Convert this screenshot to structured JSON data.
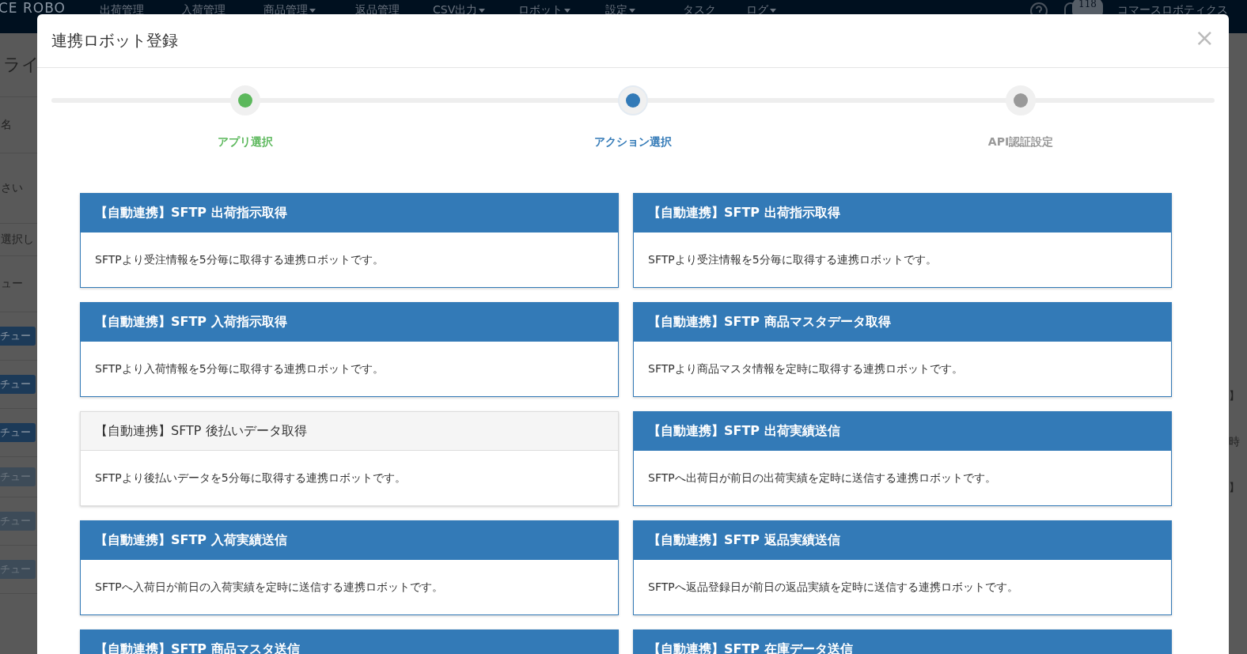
{
  "navbar": {
    "logo": "CE ROBO",
    "items": [
      {
        "label": "出荷管理",
        "dropdown": false
      },
      {
        "label": "入荷管理",
        "dropdown": false
      },
      {
        "label": "商品管理",
        "dropdown": true
      },
      {
        "label": "返品管理",
        "dropdown": false
      },
      {
        "label": "CSV出力",
        "dropdown": true
      },
      {
        "label": "ロボット",
        "dropdown": true
      },
      {
        "label": "設定",
        "dropdown": true
      },
      {
        "label": "タスク",
        "dropdown": false
      },
      {
        "label": "ログ",
        "dropdown": true
      }
    ],
    "notification_count": "118",
    "user": "コマースロボティクス"
  },
  "background_left": [
    {
      "kind": "heading",
      "text": "ライ"
    },
    {
      "kind": "text",
      "text": "名"
    },
    {
      "kind": "text",
      "text": "さい"
    },
    {
      "kind": "text",
      "text": "選択し"
    },
    {
      "kind": "text",
      "text": "ュー"
    },
    {
      "kind": "button",
      "text": "チュー",
      "disabled": false
    },
    {
      "kind": "button",
      "text": "チュー",
      "disabled": false
    },
    {
      "kind": "button",
      "text": "チュー",
      "disabled": false
    },
    {
      "kind": "button",
      "text": "チュー",
      "disabled": true
    },
    {
      "kind": "button",
      "text": "チュー",
      "disabled": true
    },
    {
      "kind": "button",
      "text": "チュー",
      "disabled": true
    }
  ],
  "background_right": [
    "】",
    "時",
    "】"
  ],
  "dialog": {
    "title": "連携ロボット登録",
    "close": "×",
    "steps": [
      {
        "label": "アプリ選択",
        "completed": true,
        "current": false
      },
      {
        "label": "アクション選択",
        "completed": false,
        "current": true
      },
      {
        "label": "API認証設定",
        "completed": false,
        "current": false
      }
    ],
    "actions": [
      {
        "title": "【自動連携】SFTP 出荷指示取得",
        "description": "SFTPより受注情報を5分毎に取得する連携ロボットです。",
        "disabled": false
      },
      {
        "title": "【自動連携】SFTP 出荷指示取得",
        "description": "SFTPより受注情報を5分毎に取得する連携ロボットです。",
        "disabled": false
      },
      {
        "title": "【自動連携】SFTP 入荷指示取得",
        "description": "SFTPより入荷情報を5分毎に取得する連携ロボットです。",
        "disabled": false
      },
      {
        "title": "【自動連携】SFTP 商品マスタデータ取得",
        "description": "SFTPより商品マスタ情報を定時に取得する連携ロボットです。",
        "disabled": false
      },
      {
        "title": "【自動連携】SFTP 後払いデータ取得",
        "description": "SFTPより後払いデータを5分毎に取得する連携ロボットです。",
        "disabled": true
      },
      {
        "title": "【自動連携】SFTP 出荷実績送信",
        "description": "SFTPへ出荷日が前日の出荷実績を定時に送信する連携ロボットです。",
        "disabled": false
      },
      {
        "title": "【自動連携】SFTP 入荷実績送信",
        "description": "SFTPへ入荷日が前日の入荷実績を定時に送信する連携ロボットです。",
        "disabled": false
      },
      {
        "title": "【自動連携】SFTP 返品実績送信",
        "description": "SFTPへ返品登録日が前日の返品実績を定時に送信する連携ロボットです。",
        "disabled": false
      },
      {
        "title": "【自動連携】SFTP 商品マスタ送信",
        "disabled": false
      },
      {
        "title": "【自動連携】SFTP 在庫データ送信",
        "disabled": false
      }
    ]
  }
}
